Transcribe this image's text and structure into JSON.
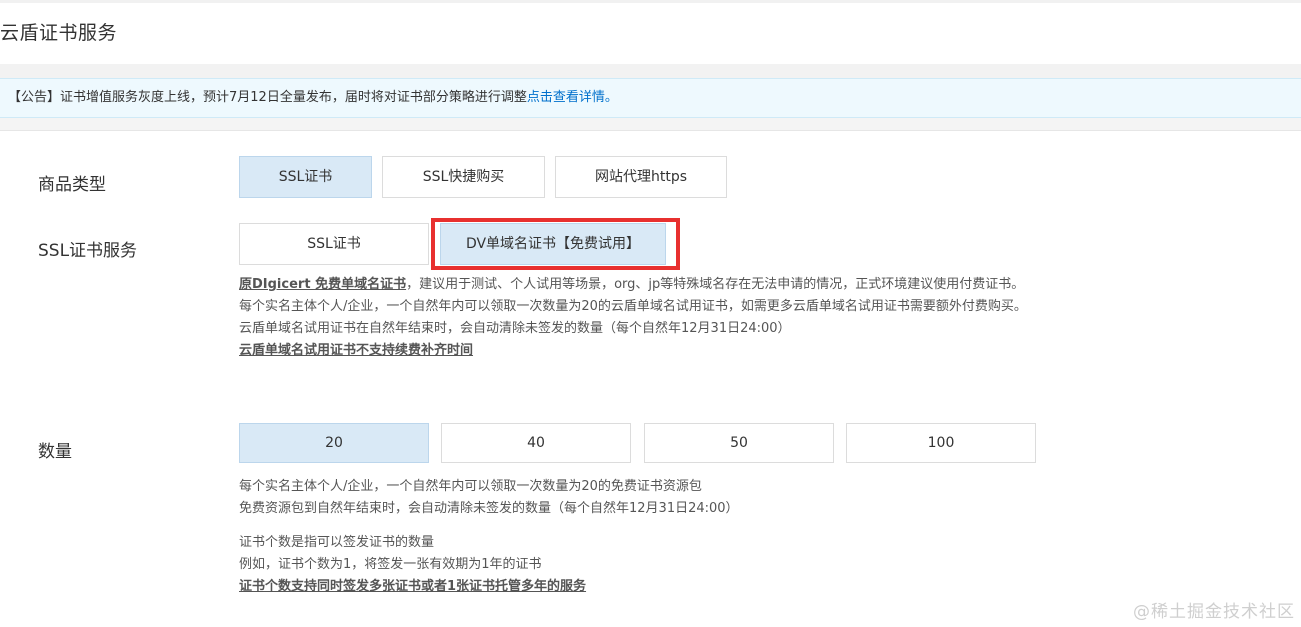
{
  "header": {
    "title": "云盾证书服务"
  },
  "notice": {
    "text": "【公告】证书增值服务灰度上线，预计7月12日全量发布，届时将对证书部分策略进行调整",
    "link": "点击查看详情。"
  },
  "product_type": {
    "label": "商品类型",
    "options": [
      {
        "label": "SSL证书",
        "selected": true
      },
      {
        "label": "SSL快捷购买",
        "selected": false
      },
      {
        "label": "网站代理https",
        "selected": false
      }
    ]
  },
  "ssl_service": {
    "label": "SSL证书服务",
    "options": [
      {
        "label": "SSL证书",
        "selected": false
      },
      {
        "label": "DV单域名证书【免费试用】",
        "selected": true
      }
    ],
    "desc": {
      "line1_em": "原DIgicert 免费单域名证书",
      "line1_rest": "，建议用于测试、个人试用等场景，org、jp等特殊域名存在无法申请的情况，正式环境建议使用付费证书。",
      "line2": "每个实名主体个人/企业，一个自然年内可以领取一次数量为20的云盾单域名试用证书，如需更多云盾单域名试用证书需要额外付费购买。",
      "line3": "云盾单域名试用证书在自然年结束时，会自动清除未签发的数量（每个自然年12月31日24:00）",
      "line4_em": "云盾单域名试用证书不支持续费补齐时间"
    }
  },
  "quantity": {
    "label": "数量",
    "options": [
      {
        "label": "20",
        "selected": true
      },
      {
        "label": "40",
        "selected": false
      },
      {
        "label": "50",
        "selected": false
      },
      {
        "label": "100",
        "selected": false
      }
    ],
    "desc": {
      "line1": "每个实名主体个人/企业，一个自然年内可以领取一次数量为20的免费证书资源包",
      "line2": "免费资源包到自然年结束时，会自动清除未签发的数量（每个自然年12月31日24:00）",
      "line3": "证书个数是指可以签发证书的数量",
      "line4": "例如，证书个数为1，将签发一张有效期为1年的证书",
      "line5_em": "证书个数支持同时签发多张证书或者1张证书托管多年的服务"
    }
  },
  "watermark": "@稀土掘金技术社区",
  "colors": {
    "selected_bg": "#d9e9f6",
    "link": "#0070cc",
    "highlight": "#e8302f",
    "notice_bg": "#eef9fe"
  }
}
